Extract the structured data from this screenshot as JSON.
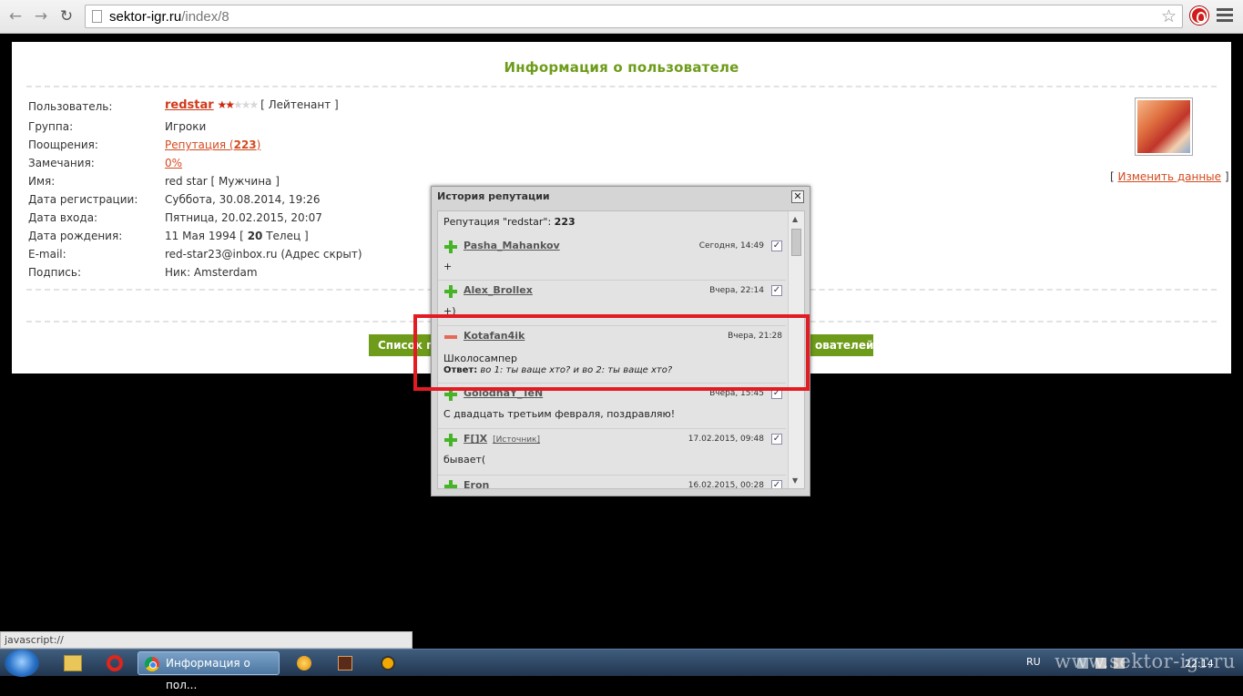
{
  "browser": {
    "url_host": "sektor-igr.ru",
    "url_path": "/index/8"
  },
  "page": {
    "title": "Информация о пользователе",
    "rows": [
      {
        "label": "Пользователь:"
      },
      {
        "label": "Группа:",
        "value": "Игроки"
      },
      {
        "label": "Поощрения:"
      },
      {
        "label": "Замечания:"
      },
      {
        "label": "Имя:",
        "value": "red star [ Мужчина ]"
      },
      {
        "label": "Дата регистрации:",
        "value": "Суббота, 30.08.2014, 19:26"
      },
      {
        "label": "Дата входа:",
        "value": "Пятница, 20.02.2015, 20:07"
      },
      {
        "label": "Дата рождения:"
      },
      {
        "label": "E-mail:",
        "value": "red-star23@inbox.ru (Адрес скрыт)"
      },
      {
        "label": "Подпись:",
        "value": "Ник: Amsterdam"
      }
    ],
    "username": "redstar",
    "rank": "[ Лейтенант ]",
    "rating_stars": 1.5,
    "rating_max": 5,
    "reputation_label": "Репутация (",
    "reputation_value": "223",
    "reputation_close": ")",
    "warnings": "0%",
    "birth_date": "11 Мая 1994 [",
    "birth_age": "20",
    "birth_sign": "Телец ]",
    "edit_open": "[",
    "edit_link": "Изменить данные",
    "edit_close": "]",
    "btn_left": "Список по",
    "btn_right": "ователей"
  },
  "modal": {
    "title": "История репутации",
    "close": "✕",
    "header_prefix": "Репутация \"redstar\": ",
    "header_value": "223",
    "entries": [
      {
        "sign": "plus",
        "author": "Pasha_Mahankov",
        "date": "Сегодня, 14:49",
        "text": "+"
      },
      {
        "sign": "plus",
        "author": "Alex_Brollex",
        "date": "Вчера, 22:14",
        "text": "+)"
      },
      {
        "sign": "minus",
        "author": "Kotafan4ik",
        "date": "Вчера, 21:28",
        "text": "Школосампер",
        "reply_label": "Ответ:",
        "reply": "во 1: ты ваще хто? и во 2: ты ваще хто?"
      },
      {
        "sign": "plus",
        "author": "GolodnaY_TeN",
        "date": "Вчера, 15:45",
        "text": "С двадцать третьим февраля, поздравляю!"
      },
      {
        "sign": "plus",
        "author": "F[]X",
        "source": "[Источник]",
        "date": "17.02.2015, 09:48",
        "text": "бывает("
      },
      {
        "sign": "plus",
        "author": "Eron",
        "date": "16.02.2015, 00:28"
      }
    ]
  },
  "status_text": "javascript://",
  "taskbar": {
    "task_label": "Информация о пол...",
    "lang": "RU",
    "watermark": "www.sektor-igr.ru",
    "clock": "22:14"
  },
  "colors": {
    "accent_green": "#6e9c1a",
    "link": "#d44a1f",
    "highlight": "#e31b23"
  }
}
